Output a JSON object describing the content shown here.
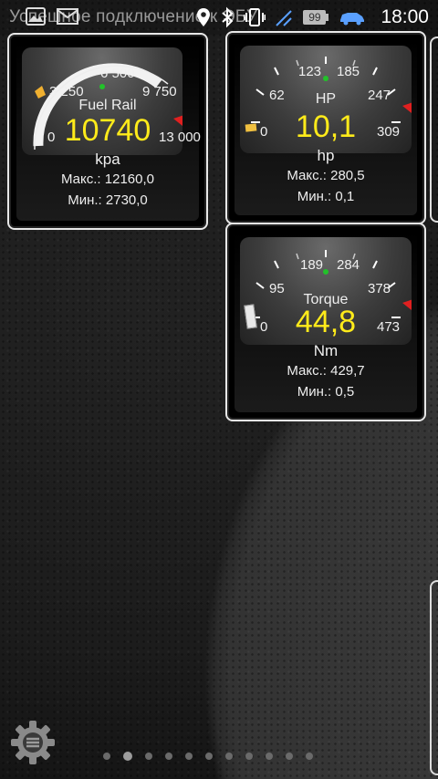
{
  "status_bar": {
    "notification_text": "Успешное подключение к ЭБУ",
    "time": "18:00",
    "battery_level": "99",
    "icons": [
      "image-icon",
      "mail-icon",
      "location-icon",
      "bluetooth-icon",
      "vibrate-icon",
      "battery-icon",
      "car-icon"
    ]
  },
  "gauges": [
    {
      "name": "Fuel Rail",
      "value": "10740",
      "unit": "kpa",
      "max_label": "Макс.: 12160,0",
      "min_label": "Мин.: 2730,0",
      "ticks": [
        "0",
        "3 250",
        "6 500",
        "9 750",
        "13 000"
      ],
      "needle_fraction": 0.826
    },
    {
      "name": "HP",
      "value": "10,1",
      "unit": "hp",
      "max_label": "Макс.: 280,5",
      "min_label": "Мин.: 0,1",
      "ticks": [
        "0",
        "62",
        "123",
        "185",
        "247",
        "309"
      ],
      "needle_fraction": 0.033
    },
    {
      "name": "Torque",
      "value": "44,8",
      "unit": "Nm",
      "max_label": "Макс.: 429,7",
      "min_label": "Мин.: 0,5",
      "ticks": [
        "0",
        "95",
        "189",
        "284",
        "378",
        "473"
      ],
      "needle_fraction": 0.095
    }
  ],
  "pager": {
    "pages": 11,
    "active_index": 1
  },
  "colors": {
    "value": "#ffeb1a",
    "green_dot": "#22c22a",
    "red_mark": "#e02020",
    "orange_mark": "#f0b030"
  }
}
